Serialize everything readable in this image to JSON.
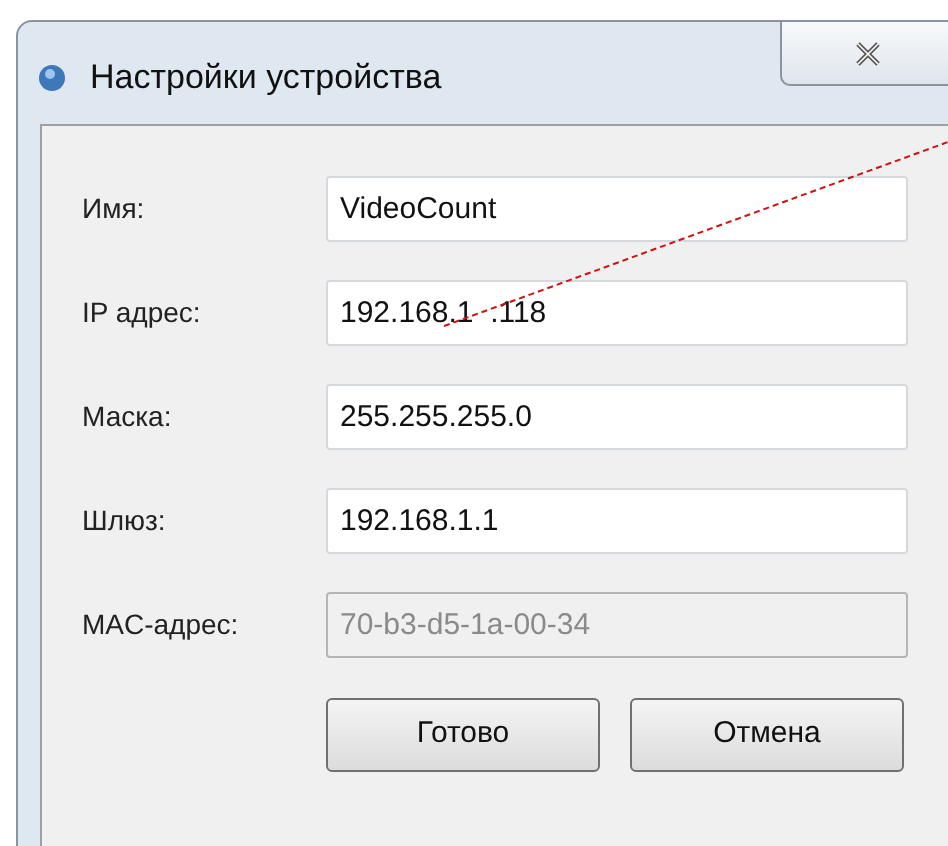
{
  "window": {
    "title": "Настройки устройства"
  },
  "fields": [
    {
      "label": "Имя:",
      "value": "VideoCount",
      "disabled": false
    },
    {
      "label": "IP адрес:",
      "value": "192.168.1  .118",
      "disabled": false
    },
    {
      "label": "Маска:",
      "value": "255.255.255.0",
      "disabled": false
    },
    {
      "label": "Шлюз:",
      "value": "192.168.1.1",
      "disabled": false
    },
    {
      "label": "MAC-адрес:",
      "value": "70-b3-d5-1a-00-34",
      "disabled": true
    }
  ],
  "buttons": [
    "Готово",
    "Отмена"
  ]
}
